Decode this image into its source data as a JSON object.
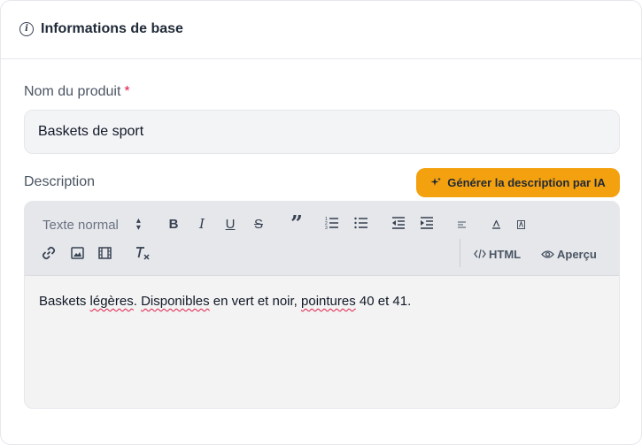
{
  "section": {
    "title": "Informations de base",
    "icon": "info-icon"
  },
  "product_name": {
    "label": "Nom du produit",
    "required_mark": "*",
    "value": "Baskets de sport"
  },
  "description": {
    "label": "Description",
    "ai_button_label": "Générer la description par IA",
    "ai_button_icon": "sparkles-icon",
    "text_parts": [
      "Baskets ",
      "légères",
      ". ",
      "Disponibles",
      " en vert et noir, ",
      "pointures",
      " 40 et 41."
    ]
  },
  "toolbar": {
    "style_select": "Texte normal",
    "bold": "B",
    "italic": "I",
    "underline": "U",
    "strike": "S",
    "quote": "”",
    "html_label": "HTML",
    "preview_label": "Aperçu",
    "icons": [
      "bold-icon",
      "italic-icon",
      "underline-icon",
      "strikethrough-icon",
      "quote-icon",
      "ordered-list-icon",
      "bullet-list-icon",
      "outdent-icon",
      "indent-icon",
      "align-icon",
      "font-color-icon",
      "background-color-icon",
      "link-icon",
      "image-icon",
      "video-icon",
      "clear-format-icon",
      "code-icon",
      "eye-icon"
    ]
  },
  "colors": {
    "accent": "#f4a10f",
    "required": "#e11d48",
    "toolbar_bg": "#e5e7eb",
    "input_bg": "#f3f4f6"
  }
}
